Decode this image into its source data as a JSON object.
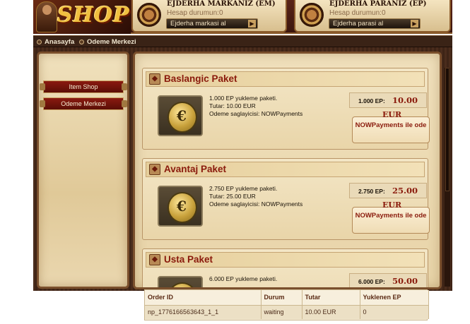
{
  "header": {
    "logo_text": "SHOP",
    "em_panel": {
      "title": "EJDERHA MARKANIZ (EM)",
      "status_label": "Hesap durumun:",
      "status_value": "0",
      "button_label": "Ejderha markasi al"
    },
    "ep_panel": {
      "title": "EJDERHA PARANIZ (EP)",
      "status_label": "Hesap durumun:",
      "status_value": "0",
      "button_label": "Ejderha parasi al"
    }
  },
  "nav": {
    "items": [
      {
        "label": "Anasayfa"
      },
      {
        "label": "Odeme Merkezi"
      }
    ]
  },
  "sidebar": {
    "items": [
      {
        "label": "Item Shop"
      },
      {
        "label": "Odeme Merkezi"
      }
    ]
  },
  "packages": [
    {
      "title": "Baslangic Paket",
      "desc1": "1.000 EP yukleme paketi.",
      "desc2": "Tutar: 10.00 EUR",
      "desc3": "Odeme saglayicisi: NOWPayments",
      "price_label": "1.000 EP:",
      "price_value": "10.00",
      "currency": "EUR",
      "pay_button": "NOWPayments ile ode"
    },
    {
      "title": "Avantaj Paket",
      "desc1": "2.750 EP yukleme paketi.",
      "desc2": "Tutar: 25.00 EUR",
      "desc3": "Odeme saglayicisi: NOWPayments",
      "price_label": "2.750 EP:",
      "price_value": "25.00",
      "currency": "EUR",
      "pay_button": "NOWPayments ile ode"
    },
    {
      "title": "Usta Paket",
      "desc1": "6.000 EP yukleme paketi.",
      "price_label": "6.000 EP:",
      "price_value": "50.00"
    }
  ],
  "orders": {
    "columns": [
      "Order ID",
      "Durum",
      "Tutar",
      "Yuklenen EP"
    ],
    "rows": [
      [
        "np_1776166563643_1_1",
        "waiting",
        "10.00 EUR",
        "0"
      ]
    ]
  },
  "colors": {
    "accent_red": "#8a1a0c",
    "frame_brown": "#4a2c1c",
    "parchment": "#f0e0bc"
  }
}
